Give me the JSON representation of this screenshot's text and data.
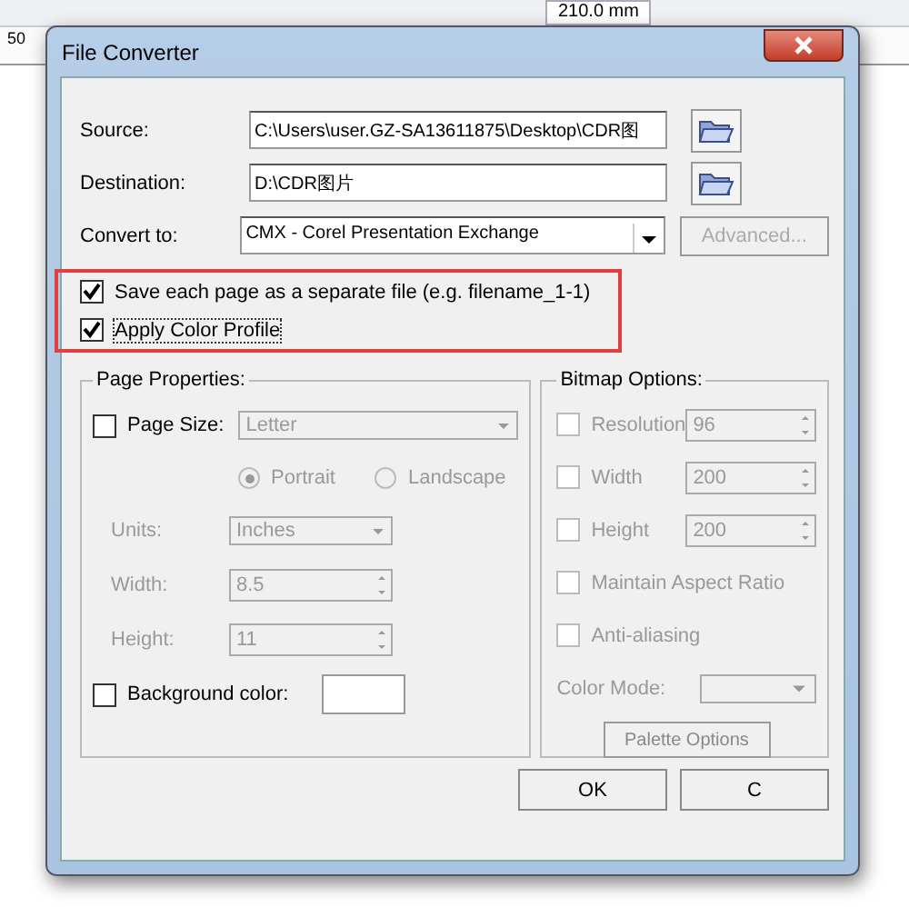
{
  "app_toolbar": {
    "page_width": "210.0 mm",
    "ruler_mark": "50"
  },
  "window": {
    "title": "File Converter"
  },
  "fields": [
    {
      "label": "Source:",
      "value": "C:\\Users\\user.GZ-SA13611875\\Desktop\\CDR图"
    },
    {
      "label": "Destination:",
      "value": "D:\\CDR图片"
    }
  ],
  "convert_to": {
    "label": "Convert to:",
    "value": "CMX - Corel Presentation Exchange"
  },
  "advanced_button": {
    "label": "Advanced...",
    "disabled": true
  },
  "options": [
    {
      "label": "Save each page as a separate file (e.g. filename_1-1)",
      "checked": true
    },
    {
      "label": "Apply Color Profile",
      "checked": true
    }
  ],
  "page_properties": {
    "title": "Page Properties:",
    "page_size": {
      "label": "Page Size:",
      "checked": false,
      "value": "Letter",
      "disabled": true
    },
    "orientation": [
      {
        "label": "Portrait",
        "selected": true
      },
      {
        "label": "Landscape",
        "selected": false
      }
    ],
    "rows": [
      {
        "kind": "dropdown",
        "label": "Units:",
        "value": "Inches"
      },
      {
        "kind": "spin",
        "label": "Width:",
        "value": "8.5"
      },
      {
        "kind": "spin",
        "label": "Height:",
        "value": "11"
      }
    ],
    "background_color": {
      "label": "Background color:",
      "checked": false
    }
  },
  "bitmap_options": {
    "title": "Bitmap Options:",
    "items": [
      {
        "kind": "spin",
        "label": "Resolution",
        "checked": false,
        "value": "96"
      },
      {
        "kind": "spin",
        "label": "Width",
        "checked": false,
        "value": "200"
      },
      {
        "kind": "spin",
        "label": "Height",
        "checked": false,
        "value": "200"
      },
      {
        "kind": "check",
        "label": "Maintain Aspect Ratio",
        "checked": false
      },
      {
        "kind": "check",
        "label": "Anti-aliasing",
        "checked": false
      }
    ],
    "color_mode": {
      "label": "Color Mode:"
    },
    "palette_button": {
      "label": "Palette Options"
    }
  },
  "buttons": [
    {
      "label": "OK"
    },
    {
      "label": "C"
    }
  ]
}
